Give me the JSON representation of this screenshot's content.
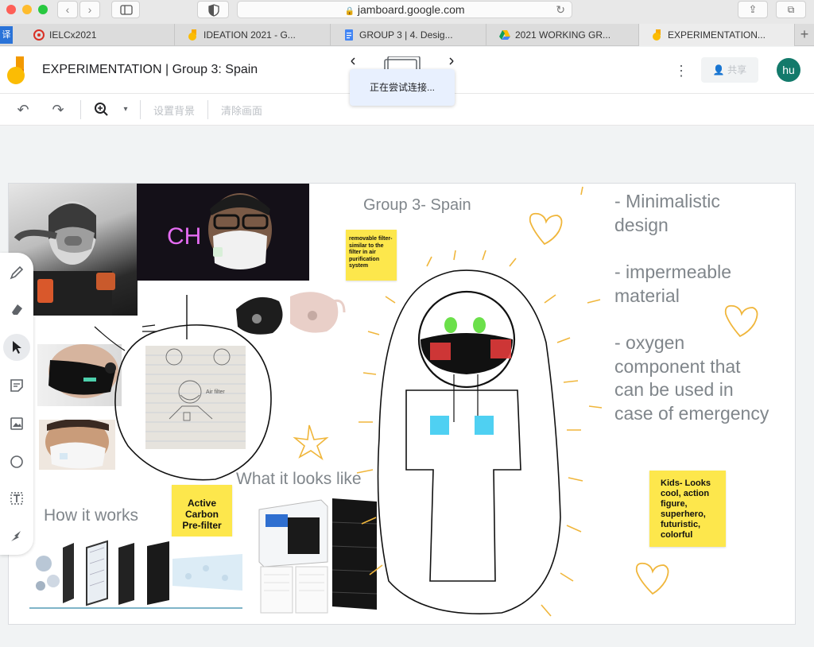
{
  "browser": {
    "url": "jamboard.google.com",
    "translate_badge": "译",
    "tabs": [
      {
        "label": "IELCx2021",
        "icon": "ielc-icon",
        "color": "#d93025"
      },
      {
        "label": "IDEATION 2021 - G...",
        "icon": "jamboard-icon",
        "color": "#f9ab00"
      },
      {
        "label": "GROUP 3 | 4. Desig...",
        "icon": "google-docs-icon",
        "color": "#4285f4"
      },
      {
        "label": "2021 WORKING GR...",
        "icon": "google-drive-icon",
        "color": "#0f9d58"
      },
      {
        "label": "EXPERIMENTATION...",
        "icon": "jamboard-icon",
        "color": "#f9ab00"
      }
    ]
  },
  "app": {
    "title": "EXPERIMENTATION | Group 3: Spain",
    "toast": "正在尝试连接...",
    "share_label": "共享",
    "avatar_initials": "hu",
    "accent": "#137a6b"
  },
  "toolbar": {
    "set_background": "设置背景",
    "clear_frame": "清除画面"
  },
  "rail": [
    "pen-icon",
    "eraser-icon",
    "select-icon",
    "sticky-note-icon",
    "image-icon",
    "circle-icon",
    "text-box-icon",
    "laser-icon"
  ],
  "board": {
    "heading": "Group 3- Spain",
    "notes": [
      "- Minimalistic design",
      "- impermeable material",
      "- oxygen component that can be used in case of emergency"
    ],
    "how_it_works": "How it works",
    "what_it_looks_like": "What it looks like",
    "sketch_label": "Air filter",
    "stickies": {
      "filter": "removable filter- similar to the filter in air purification system",
      "carbon": "Active Carbon Pre-filter",
      "kids": "Kids- Looks cool, action figure, superhero, futuristic, colorful"
    },
    "photo_neon_text": "CH",
    "sticky_color": "#fde74c"
  }
}
